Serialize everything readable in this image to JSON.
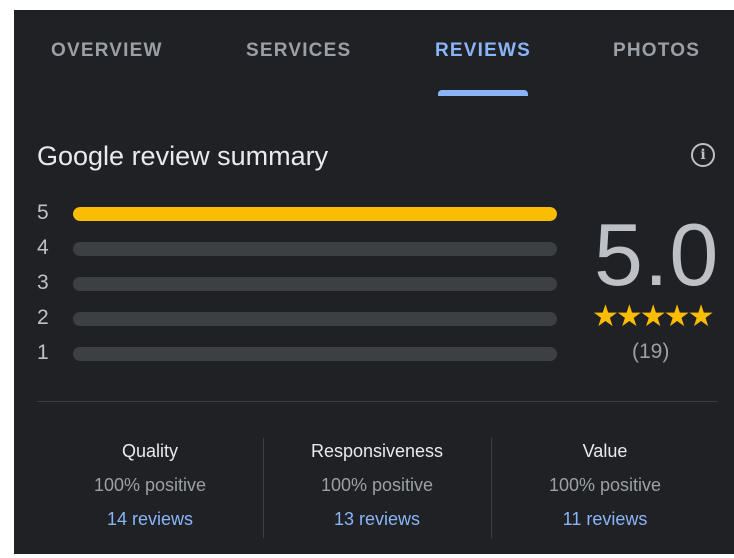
{
  "tabs": [
    {
      "label": "OVERVIEW"
    },
    {
      "label": "SERVICES"
    },
    {
      "label": "REVIEWS"
    },
    {
      "label": "PHOTOS"
    }
  ],
  "active_tab": "REVIEWS",
  "summary": {
    "title": "Google review summary",
    "info_icon": "info-icon",
    "ratings": [
      {
        "label": "5",
        "fraction": 1.0
      },
      {
        "label": "4",
        "fraction": 0.0
      },
      {
        "label": "3",
        "fraction": 0.0
      },
      {
        "label": "2",
        "fraction": 0.0
      },
      {
        "label": "1",
        "fraction": 0.0
      }
    ],
    "average": "5.0",
    "stars": "★★★★★",
    "review_count": "(19)"
  },
  "categories": [
    {
      "name": "Quality",
      "positive": "100% positive",
      "reviews": "14 reviews"
    },
    {
      "name": "Responsiveness",
      "positive": "100% positive",
      "reviews": "13 reviews"
    },
    {
      "name": "Value",
      "positive": "100% positive",
      "reviews": "11 reviews"
    }
  ],
  "colors": {
    "background": "#202124",
    "accent": "#8ab4f8",
    "star": "#fbbc04",
    "track": "#3c4043"
  }
}
